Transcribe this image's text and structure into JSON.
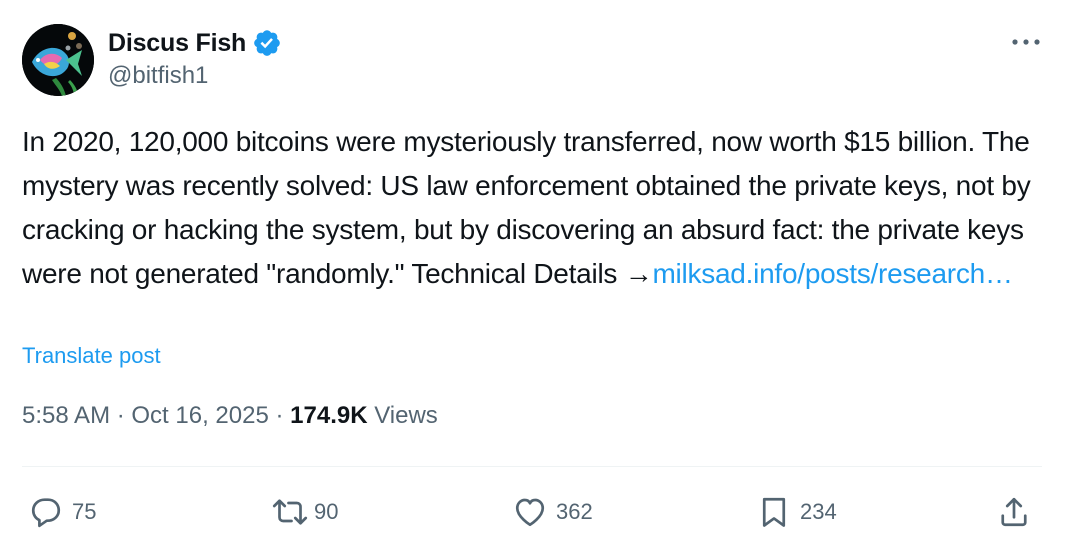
{
  "author": {
    "display_name": "Discus Fish",
    "handle": "@bitfish1",
    "verified_icon": "verified-badge-icon",
    "avatar_icon": "fish-avatar"
  },
  "post": {
    "text_main": "In 2020, 120,000 bitcoins were mysteriously transferred, now worth $15 billion. The mystery was recently solved: US law enforcement obtained the private keys, not by cracking or hacking the system, but by discovering an absurd fact: the private keys were not generated \"randomly.\" Technical Details →",
    "link_text": "milksad.info/posts/research…",
    "translate_label": "Translate post"
  },
  "meta": {
    "time": "5:58 AM",
    "separator": " · ",
    "date": "Oct 16, 2025",
    "views_count": "174.9K",
    "views_label": " Views"
  },
  "actions": {
    "replies": "75",
    "reposts": "90",
    "likes": "362",
    "bookmarks": "234"
  },
  "colors": {
    "text": "#0f1419",
    "secondary": "#536471",
    "accent": "#1d9bf0"
  }
}
